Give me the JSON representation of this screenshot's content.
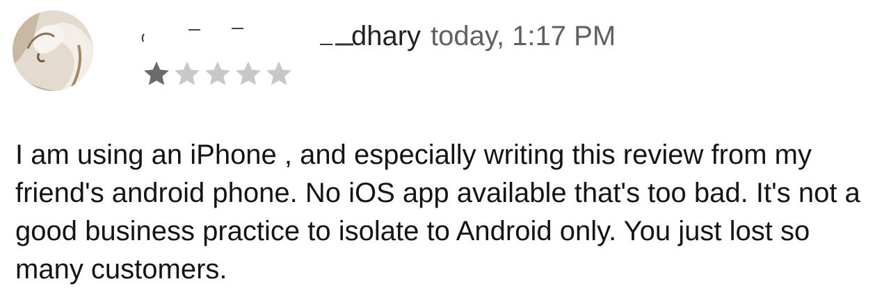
{
  "review": {
    "reviewer_name_visible": "dhary",
    "date": "today, 1:17 PM",
    "rating": 1,
    "rating_max": 5,
    "body": "I am using an iPhone , and especially writing this review from my friend's android phone. No iOS app available that's too bad. It's not a good business practice to isolate to Android only. You just lost so many customers."
  },
  "colors": {
    "star_filled": "#6b6b6b",
    "star_empty": "#c8c8c8",
    "date_text": "#5f5f5f"
  },
  "icons": {
    "avatar": "user-avatar",
    "star": "star-icon"
  }
}
